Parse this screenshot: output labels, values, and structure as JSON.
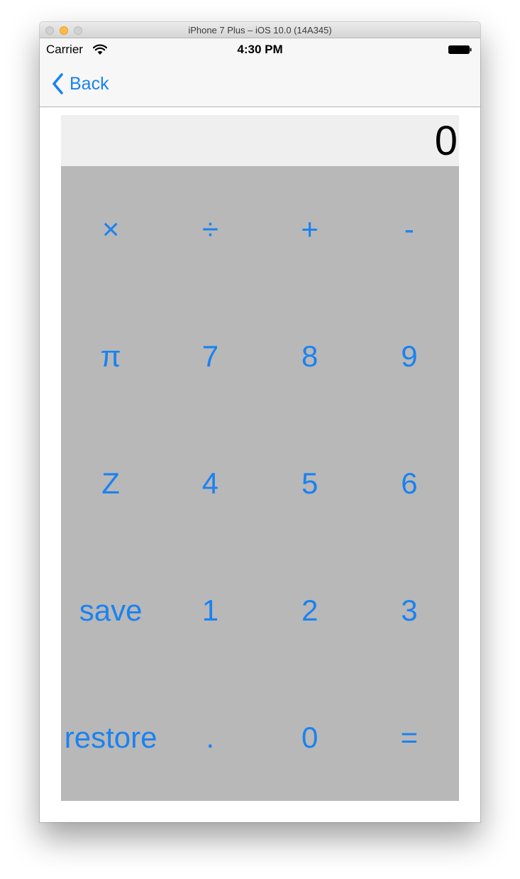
{
  "window": {
    "title": "iPhone 7 Plus – iOS 10.0 (14A345)"
  },
  "status_bar": {
    "carrier": "Carrier",
    "time": "4:30 PM",
    "wifi_icon": "wifi-icon",
    "battery_icon": "battery-icon"
  },
  "nav": {
    "back_label": "Back",
    "back_icon": "chevron-left-icon"
  },
  "display": {
    "value": "0"
  },
  "keys": [
    [
      "×",
      "÷",
      "+",
      "-"
    ],
    [
      "π",
      "7",
      "8",
      "9"
    ],
    [
      "Z",
      "4",
      "5",
      "6"
    ],
    [
      "save",
      "1",
      "2",
      "3"
    ],
    [
      "restore",
      ".",
      "0",
      "="
    ]
  ],
  "colors": {
    "accent": "#1a82f0",
    "keypad_background": "#b8b8b8",
    "display_background": "#efefef"
  }
}
